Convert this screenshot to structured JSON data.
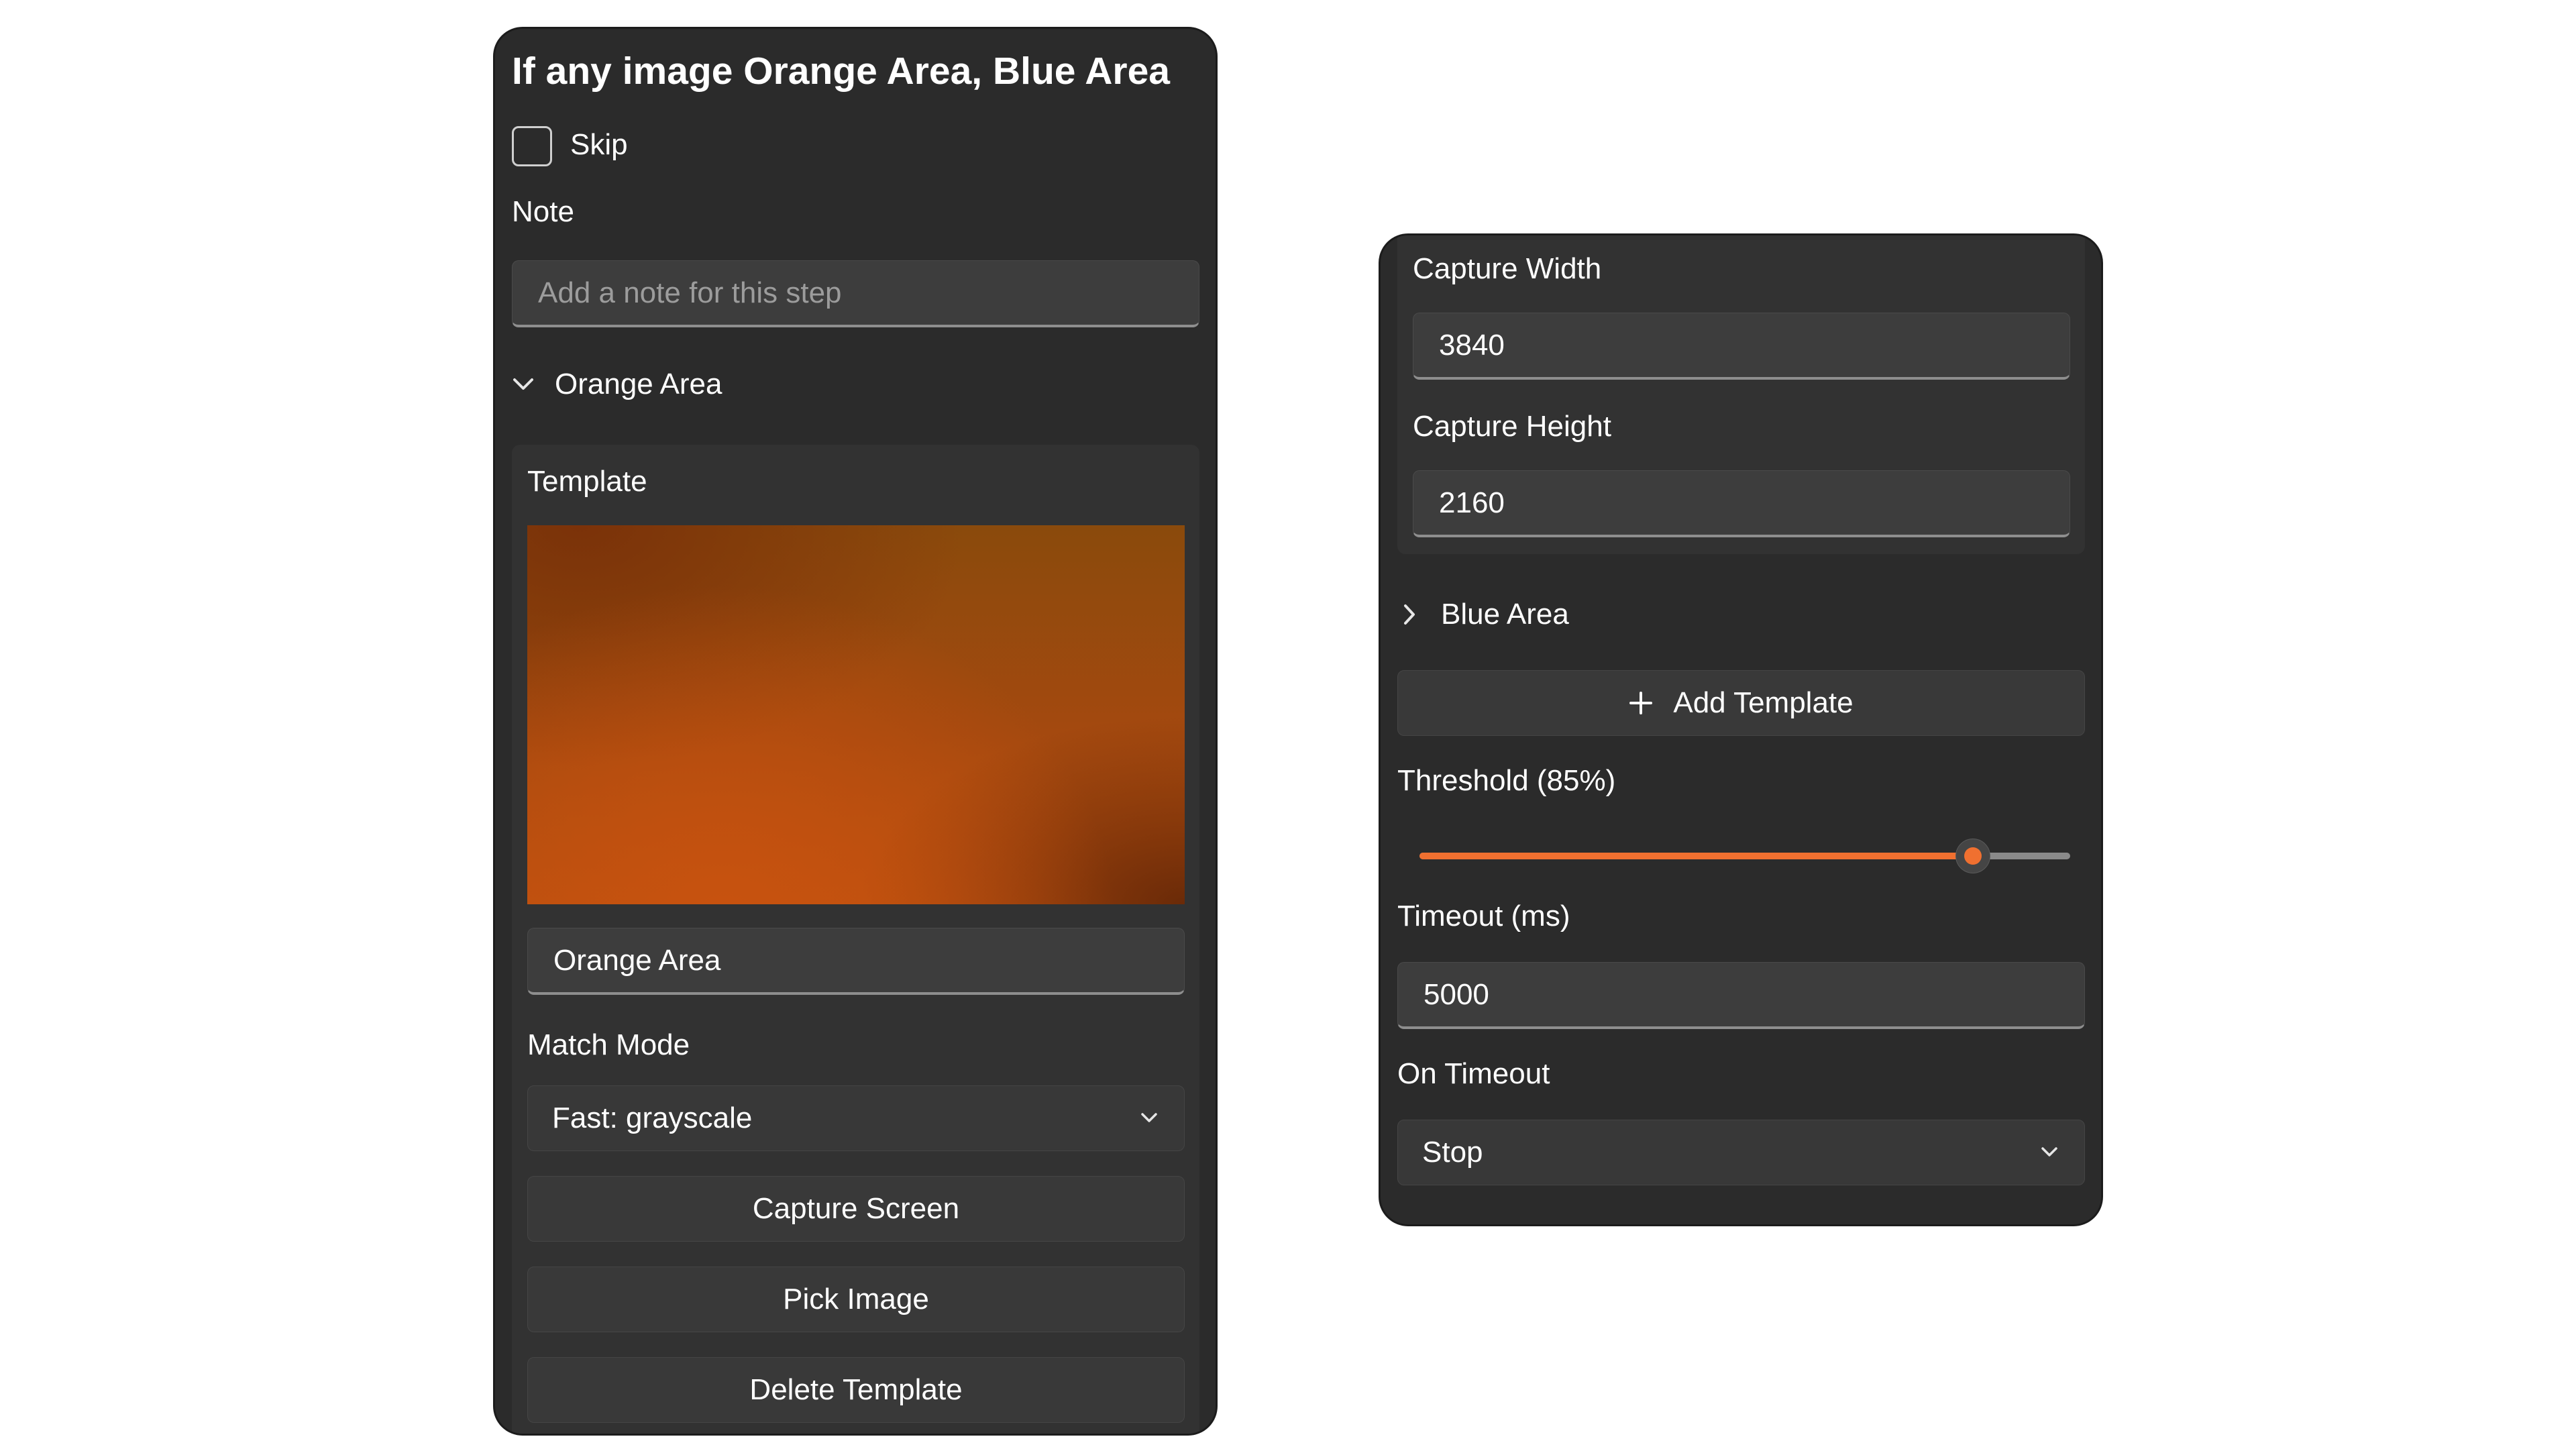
{
  "left_panel": {
    "title": "If any image Orange Area, Blue Area",
    "skip_label": "Skip",
    "note_label": "Note",
    "note_placeholder": "Add a note for this step",
    "orange_section": {
      "header": "Orange Area",
      "expanded": true,
      "template_label": "Template",
      "template_name_value": "Orange Area",
      "match_mode_label": "Match Mode",
      "match_mode_value": "Fast: grayscale",
      "capture_screen_label": "Capture Screen",
      "pick_image_label": "Pick Image",
      "delete_template_label": "Delete Template"
    }
  },
  "right_panel": {
    "capture_width_label": "Capture Width",
    "capture_width_value": "3840",
    "capture_height_label": "Capture Height",
    "capture_height_value": "2160",
    "blue_section": {
      "header": "Blue Area",
      "expanded": false
    },
    "add_template_label": "Add Template",
    "threshold_label": "Threshold (85%)",
    "threshold_value": 0.85,
    "timeout_label": "Timeout (ms)",
    "timeout_value": "5000",
    "on_timeout_label": "On Timeout",
    "on_timeout_value": "Stop"
  },
  "colors": {
    "accent": "#f07030",
    "panel_bg": "#2b2b2b",
    "field_bg": "#3d3d3d"
  },
  "icons": [
    "chevron-down-icon",
    "chevron-right-icon",
    "plus-icon"
  ]
}
